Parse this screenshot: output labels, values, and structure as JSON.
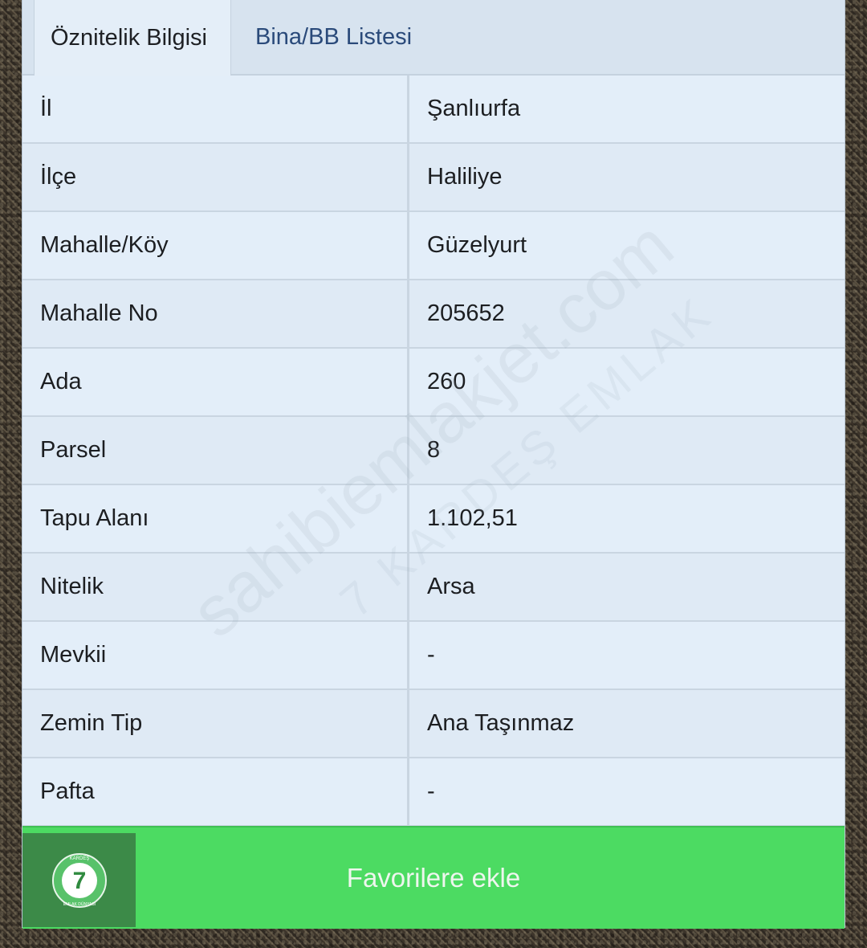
{
  "tabs": [
    {
      "label": "Öznitelik Bilgisi",
      "active": true
    },
    {
      "label": "Bina/BB Listesi",
      "active": false
    }
  ],
  "rows": [
    {
      "label": "İl",
      "value": "Şanlıurfa"
    },
    {
      "label": "İlçe",
      "value": "Haliliye"
    },
    {
      "label": "Mahalle/Köy",
      "value": "Güzelyurt"
    },
    {
      "label": "Mahalle No",
      "value": "205652"
    },
    {
      "label": "Ada",
      "value": "260"
    },
    {
      "label": "Parsel",
      "value": "8"
    },
    {
      "label": "Tapu Alanı",
      "value": "1.102,51"
    },
    {
      "label": "Nitelik",
      "value": "Arsa"
    },
    {
      "label": "Mevkii",
      "value": "-"
    },
    {
      "label": "Zemin Tip",
      "value": "Ana Taşınmaz"
    },
    {
      "label": "Pafta",
      "value": "-"
    }
  ],
  "favorite_button": {
    "label": "Favorilere ekle"
  },
  "logo": {
    "number": "7",
    "top_text": "KARDEŞ",
    "bottom_text": "EMLAK DÜNYASI",
    "icon": "seven-logo-icon"
  },
  "watermark": {
    "line1": "sahibiemlakjet.com",
    "line2": "7 KARDEŞ EMLAK"
  },
  "colors": {
    "panel_bg": "#e1ecf7",
    "tab_link": "#2a4a7a",
    "button_green": "#4cdb62",
    "logo_green": "#3c8a48"
  }
}
